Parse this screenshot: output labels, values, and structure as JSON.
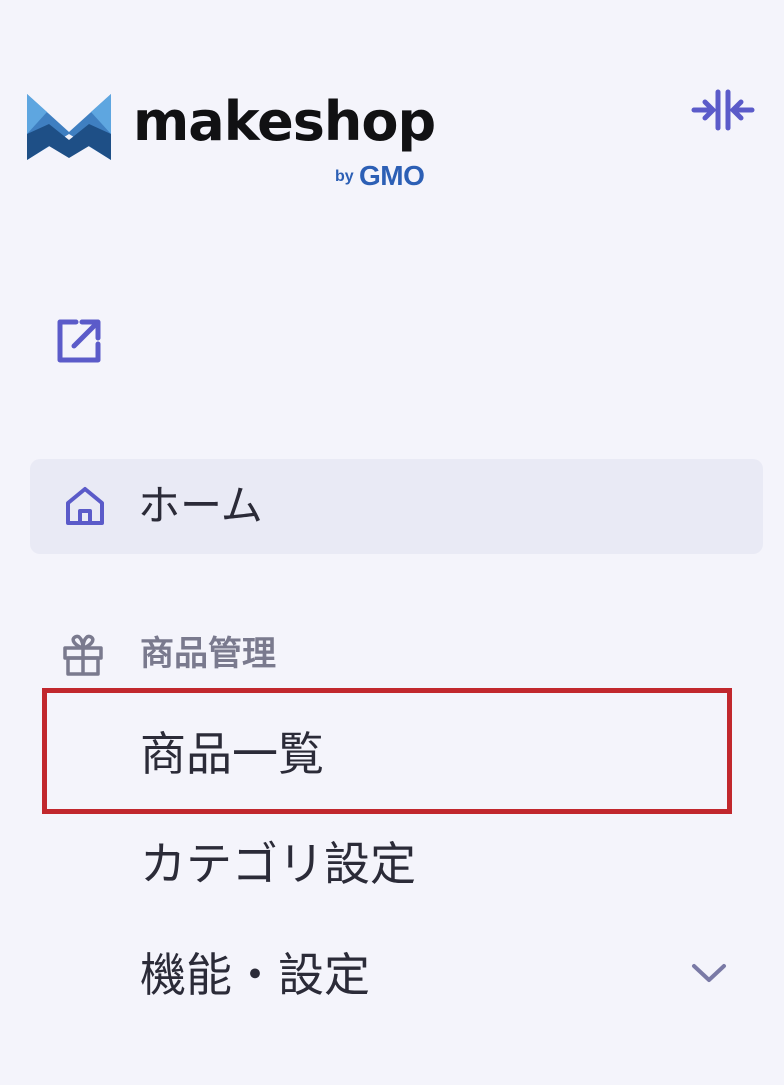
{
  "brand": {
    "wordmark": "makeshop",
    "by": "by",
    "company": "GMO",
    "colors": {
      "accent": "#5b5bc9",
      "logo_blue_dark": "#1e4f86",
      "logo_blue_mid": "#3f7fc1",
      "logo_blue_light": "#5ea6e0",
      "gmo_blue": "#2c5fb5"
    }
  },
  "header": {
    "collapse_icon": "collapse-sidebar-icon",
    "external_icon": "external-link-icon"
  },
  "nav": {
    "home": {
      "label": "ホーム",
      "icon": "home-icon",
      "active": true
    },
    "section": {
      "label": "商品管理",
      "icon": "gift-icon"
    },
    "items": [
      {
        "label": "商品一覧",
        "highlighted": true
      },
      {
        "label": "カテゴリ設定"
      },
      {
        "label": "機能・設定",
        "icon": "chevron-down-icon"
      }
    ]
  },
  "annotation": {
    "highlight_color": "#c1272d"
  }
}
